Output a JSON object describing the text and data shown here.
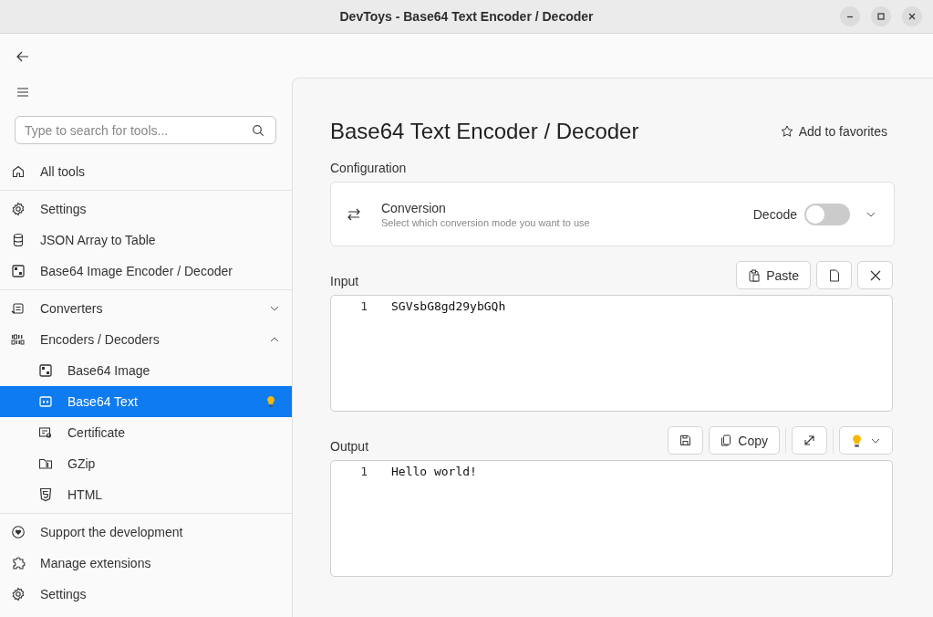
{
  "window": {
    "title": "DevToys - Base64 Text Encoder / Decoder"
  },
  "sidebar": {
    "search": {
      "placeholder": "Type to search for tools..."
    },
    "groups": [
      [
        {
          "label": "All tools",
          "kind": "home",
          "selected": false,
          "suggested": false
        }
      ],
      [
        {
          "label": "Settings",
          "kind": "gear",
          "selected": false,
          "suggested": false
        },
        {
          "label": "JSON Array to Table",
          "kind": "database",
          "selected": false,
          "suggested": false
        },
        {
          "label": "Base64 Image Encoder / Decoder",
          "kind": "image64",
          "selected": false,
          "suggested": false
        }
      ],
      [
        {
          "label": "Converters",
          "kind": "convert",
          "selected": false,
          "suggested": false,
          "expanded": false
        },
        {
          "label": "Encoders / Decoders",
          "kind": "binary",
          "selected": false,
          "suggested": false,
          "expanded": true,
          "children": [
            {
              "label": "Base64 Image",
              "kind": "image64",
              "selected": false,
              "suggested": false
            },
            {
              "label": "Base64 Text",
              "kind": "text64",
              "selected": true,
              "suggested": true
            },
            {
              "label": "Certificate",
              "kind": "certificate",
              "selected": false,
              "suggested": false
            },
            {
              "label": "GZip",
              "kind": "zip",
              "selected": false,
              "suggested": false
            },
            {
              "label": "HTML",
              "kind": "html",
              "selected": false,
              "suggested": false
            }
          ]
        }
      ]
    ],
    "footer": [
      {
        "label": "Support the development",
        "kind": "heart",
        "selected": false
      },
      {
        "label": "Manage extensions",
        "kind": "puzzle",
        "selected": false
      },
      {
        "label": "Settings",
        "kind": "gear",
        "selected": false
      }
    ]
  },
  "main": {
    "title": "Base64 Text Encoder / Decoder",
    "favorite": {
      "label": "Add to favorites",
      "on": false
    },
    "configuration": {
      "heading": "Configuration",
      "title": "Conversion",
      "description": "Select which conversion mode you want to use",
      "toggle": {
        "label": "Decode",
        "on": false
      }
    },
    "input": {
      "label": "Input",
      "paste": "Paste",
      "lines": [
        {
          "number": "1",
          "text": "SGVsbG8gd29ybGQh"
        }
      ]
    },
    "output": {
      "label": "Output",
      "copy": "Copy",
      "lines": [
        {
          "number": "1",
          "text": "Hello world!"
        }
      ]
    }
  }
}
